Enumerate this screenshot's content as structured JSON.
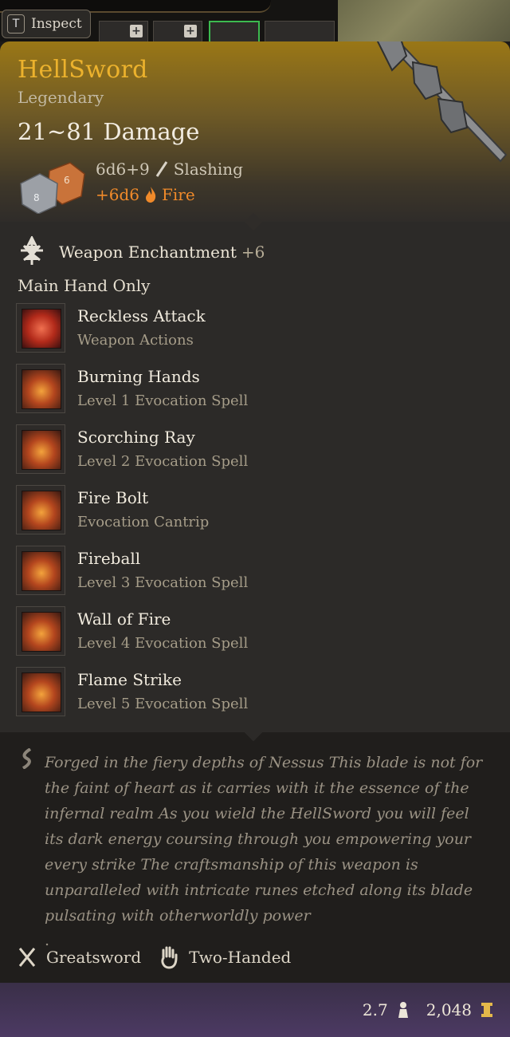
{
  "toolbar": {
    "inspect_key": "T",
    "inspect_label": "Inspect"
  },
  "item": {
    "name": "HellSword",
    "rarity": "Legendary",
    "damage": "21~81 Damage",
    "base_damage": "6d6+9",
    "base_type": "Slashing",
    "bonus_damage": "+6d6",
    "bonus_type": "Fire"
  },
  "enchantment": {
    "label": "Weapon Enchantment",
    "bonus": "+6"
  },
  "main_hand": "Main Hand Only",
  "spells": [
    {
      "name": "Reckless Attack",
      "sub": "Weapon Actions",
      "icon": "reckless-attack-icon"
    },
    {
      "name": "Burning Hands",
      "sub": "Level 1 Evocation Spell",
      "icon": "burning-hands-icon"
    },
    {
      "name": "Scorching Ray",
      "sub": "Level 2 Evocation Spell",
      "icon": "scorching-ray-icon"
    },
    {
      "name": "Fire Bolt",
      "sub": "Evocation Cantrip",
      "icon": "fire-bolt-icon"
    },
    {
      "name": "Fireball",
      "sub": "Level 3 Evocation Spell",
      "icon": "fireball-icon"
    },
    {
      "name": "Wall of Fire",
      "sub": "Level 4 Evocation Spell",
      "icon": "wall-of-fire-icon"
    },
    {
      "name": "Flame Strike",
      "sub": "Level 5 Evocation Spell",
      "icon": "flame-strike-icon"
    }
  ],
  "description": "Forged in the fiery depths of Nessus This blade is not for the faint of heart as it carries with it the essence of the infernal realm As you wield the HellSword you will feel its dark energy coursing through you empowering your every strike The craftsmanship of this weapon is unparalleled with intricate runes etched along its blade pulsating with otherworldly power",
  "description_dot": ".",
  "properties": {
    "type": "Greatsword",
    "handed": "Two-Handed"
  },
  "stats": {
    "weight": "2.7",
    "value": "2,048"
  },
  "colors": {
    "legendary": "#ecb22d",
    "fire": "#f08a2a"
  }
}
